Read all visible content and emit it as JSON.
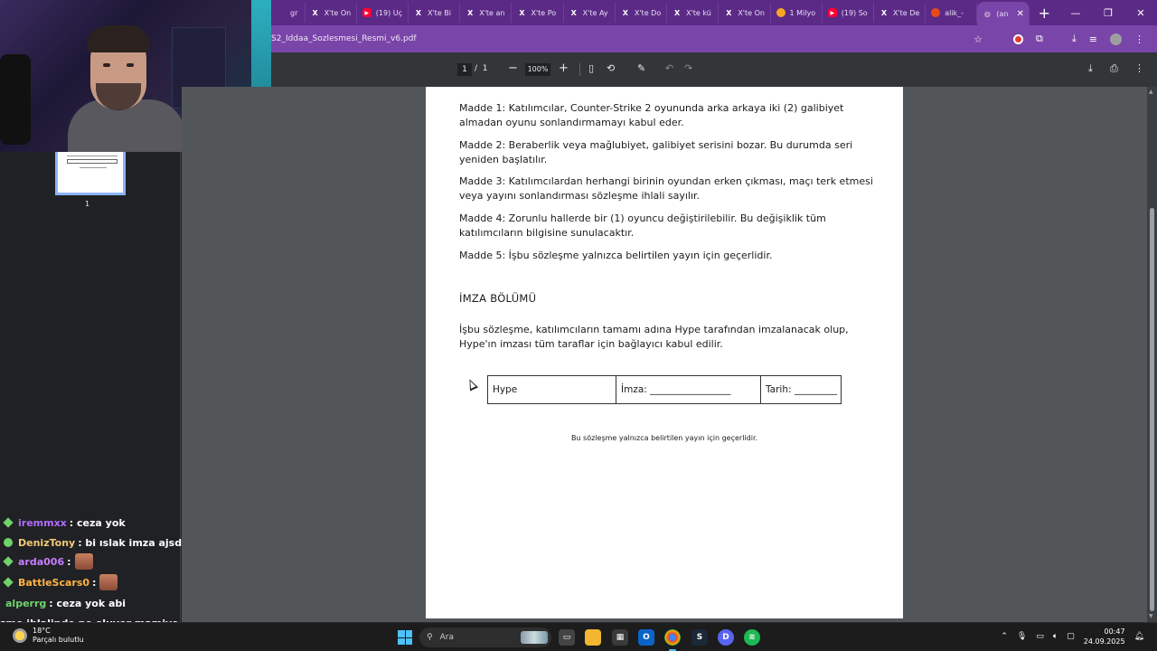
{
  "browser": {
    "tabs": [
      {
        "label": "gr",
        "icon": "globe-icon"
      },
      {
        "label": "X'te On",
        "icon": "x-icon"
      },
      {
        "label": "(19) Uç",
        "icon": "youtube-icon"
      },
      {
        "label": "X'te Bi",
        "icon": "x-icon"
      },
      {
        "label": "X'te an",
        "icon": "x-icon"
      },
      {
        "label": "X'te Po",
        "icon": "x-icon"
      },
      {
        "label": "X'te Ay",
        "icon": "x-icon"
      },
      {
        "label": "X'te Do",
        "icon": "x-icon"
      },
      {
        "label": "X'te kü",
        "icon": "x-icon"
      },
      {
        "label": "X'te On",
        "icon": "x-icon"
      },
      {
        "label": "1 Milyo",
        "icon": "game-icon"
      },
      {
        "label": "(19) So",
        "icon": "youtube-icon"
      },
      {
        "label": "X'te De",
        "icon": "x-icon"
      },
      {
        "label": "alik_-",
        "icon": "reddit-icon"
      },
      {
        "label": "(an",
        "icon": "globe-icon",
        "active": true
      }
    ],
    "url": "S2_Iddaa_Sozlesmesi_Resmi_v6.pdf"
  },
  "pdf_toolbar": {
    "page_current": "1",
    "page_total": "1",
    "page_separator": "/",
    "zoom": "100%"
  },
  "sidebar": {
    "thumbnail_page_number": "1"
  },
  "document": {
    "articles": [
      "Madde 1: Katılımcılar, Counter-Strike 2 oyununda arka arkaya iki (2) galibiyet almadan oyunu sonlandırmamayı kabul eder.",
      "Madde 2: Beraberlik veya mağlubiyet, galibiyet serisini bozar. Bu durumda seri yeniden başlatılır.",
      "Madde 3: Katılımcılardan herhangi birinin oyundan erken çıkması, maçı terk etmesi veya yayını sonlandırması sözleşme ihlali sayılır.",
      "Madde 4: Zorunlu hallerde bir (1) oyuncu değiştirilebilir. Bu değişiklik tüm katılımcıların bilgisine sunulacaktır.",
      "Madde 5: İşbu sözleşme yalnızca belirtilen yayın için geçerlidir."
    ],
    "signature_heading": "İMZA BÖLÜMÜ",
    "signature_paragraph": "İşbu sözleşme, katılımcıların tamamı adına Hype tarafından imzalanacak olup, Hype'ın imzası tüm taraflar için bağlayıcı kabul edilir.",
    "signature_table": {
      "name": "Hype",
      "signature": "İmza: _________________",
      "date": "Tarih: _________"
    },
    "footer": "Bu sözleşme yalnızca belirtilen yayın için geçerlidir."
  },
  "chat": [
    {
      "user": "iremmxx",
      "message": ": ceza yok",
      "badge": "diamond",
      "color": "#b36bff"
    },
    {
      "user": "DenizTony",
      "message": ": bi ıslak imza ajsd",
      "badge": "dot",
      "color": "#f3c979"
    },
    {
      "user": "arda006",
      "message": ":",
      "badge": "diamond",
      "color": "#c77dff",
      "emote": true
    },
    {
      "user": "BattleScars0",
      "message": ":",
      "badge": "diamond",
      "color": "#ffb347",
      "emote": true
    },
    {
      "user": "alperrg",
      "message": ": ceza yok abi",
      "badge": "none",
      "color": "#6fd36a"
    },
    {
      "user": "",
      "message": "şme ihlalinde ne oluyor mamiye",
      "badge": "none",
      "color": "#ffffff"
    }
  ],
  "taskbar": {
    "weather_temp": "18°C",
    "weather_desc": "Parçalı bulutlu",
    "search_placeholder": "Ara",
    "time": "00:47",
    "date": "24.09.2025"
  },
  "colors": {
    "tab_strip": "#5b2a86",
    "address_bar": "#7a45a8",
    "pdf_toolbar": "#323639",
    "viewer_bg": "#525659"
  }
}
